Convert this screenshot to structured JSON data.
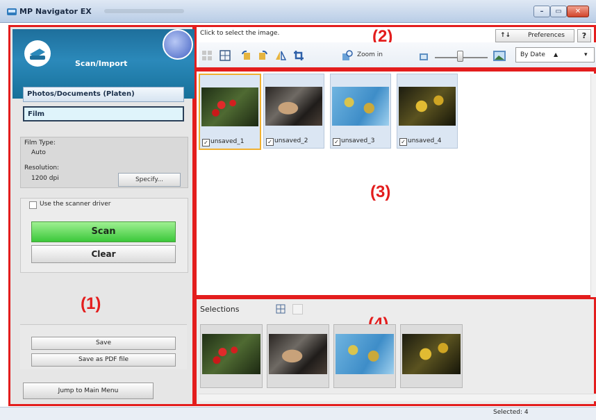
{
  "window": {
    "title": "MP Navigator EX",
    "min_glyph": "–",
    "max_glyph": "▭",
    "close_glyph": "✕"
  },
  "left_panel": {
    "callout": "(1)",
    "mode_title": "Scan/Import",
    "source_options": [
      "Photos/Documents (Platen)",
      "Film"
    ],
    "selected_source": "Film",
    "film_type_label": "Film Type:",
    "film_type_value": "Auto",
    "resolution_label": "Resolution:",
    "resolution_value": "1200 dpi",
    "specify_label": "Specify...",
    "use_driver_label": "Use the scanner driver",
    "use_driver_checked": false,
    "scan_label": "Scan",
    "clear_label": "Clear",
    "save_label": "Save",
    "save_pdf_label": "Save as PDF file",
    "jump_label": "Jump to Main Menu"
  },
  "toolbar_panel": {
    "callout": "(2)",
    "hint": "Click to select the image.",
    "preferences_label": "Preferences",
    "help_label": "?",
    "zoom_label": "Zoom in",
    "sort_value": "By Date",
    "sort_dir": "▲",
    "sort_arrow": "▾",
    "icons": [
      "select-all-icon",
      "grid-icon",
      "rotate-left-icon",
      "rotate-right-icon",
      "mirror-icon",
      "crop-icon",
      "zoom-in-icon",
      "small-thumb-icon",
      "large-thumb-icon"
    ]
  },
  "thumbnails_panel": {
    "callout": "(3)",
    "items": [
      {
        "name": "unsaved_1",
        "checked": true,
        "selected": true
      },
      {
        "name": "unsaved_2",
        "checked": true,
        "selected": false
      },
      {
        "name": "unsaved_3",
        "checked": true,
        "selected": false
      },
      {
        "name": "unsaved_4",
        "checked": true,
        "selected": false
      }
    ]
  },
  "selections_panel": {
    "callout": "(4)",
    "title": "Selections",
    "count": 4
  },
  "status": {
    "text": "Selected: 4"
  },
  "colors": {
    "callout_red": "#e31d1d",
    "scan_green": "#3bc83a",
    "header_blue": "#2b89ba"
  }
}
